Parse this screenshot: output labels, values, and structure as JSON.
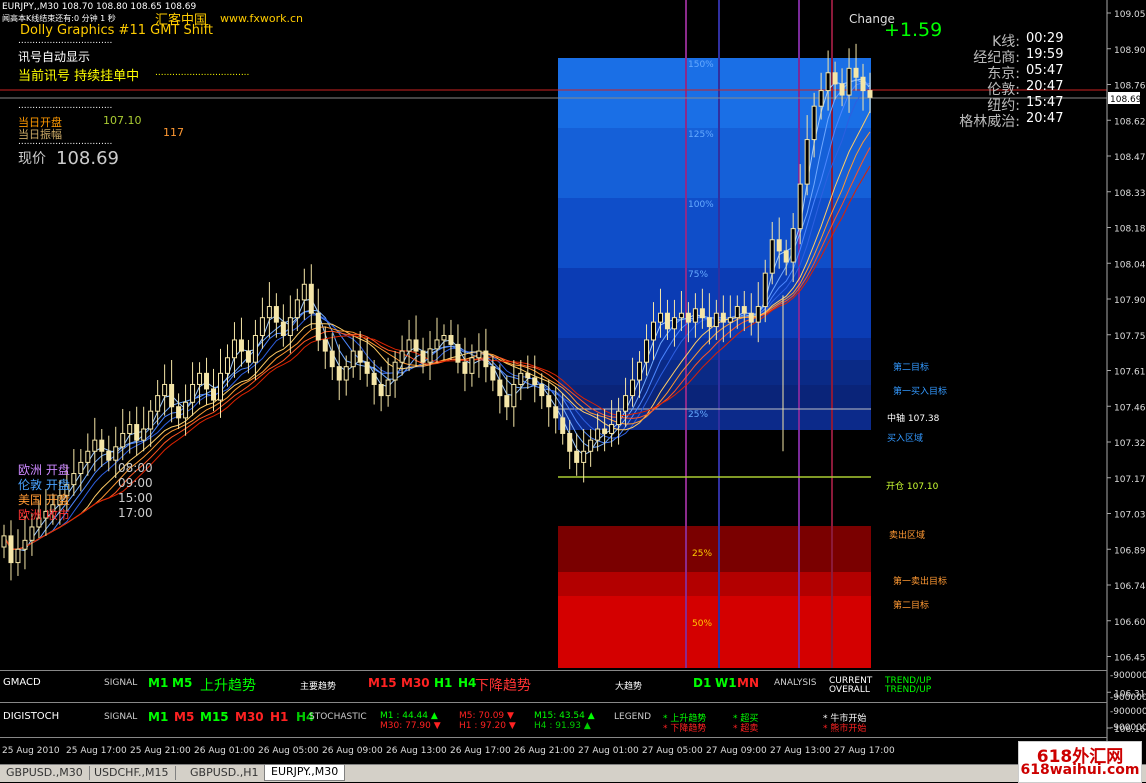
{
  "window": {
    "symbol_line": "EURJPY,,M30  108.70 108.80 108.65 108.69",
    "subtitle_line": "闻高本K线结束还有:0 分钟 1 秒",
    "brand_cn": "汇客中国",
    "brand_url": "www.fxwork.cn",
    "indicator_name": "Dolly Graphics #11 GMT Shift"
  },
  "left_panel": {
    "signal_display_label": "讯号自动显示",
    "current_signal": "当前讯号 持续挂单中",
    "dots": ".................................",
    "day_open_label": "当日开盘",
    "day_open_value": "107.10",
    "day_range_label": "当日振幅",
    "day_range_value": "117",
    "price_label": "现价",
    "price_value": "108.69"
  },
  "change": {
    "label": "Change",
    "value": "+1.59"
  },
  "clocks": [
    {
      "label": "K线:",
      "time": "00:29"
    },
    {
      "label": "经纪商:",
      "time": "19:59"
    },
    {
      "label": "东京:",
      "time": "05:47"
    },
    {
      "label": "伦敦:",
      "time": "20:47"
    },
    {
      "label": "纽约:",
      "time": "15:47"
    },
    {
      "label": "格林威治:",
      "time": "20:47"
    }
  ],
  "sessions": [
    {
      "label": "欧洲 开盘",
      "time": "08:00",
      "color": "#cc88ff"
    },
    {
      "label": "伦敦 开盘",
      "time": "09:00",
      "color": "#4aa3ff"
    },
    {
      "label": "美国 开盘",
      "time": "15:00",
      "color": "#ff9933"
    },
    {
      "label": "欧洲 收市",
      "time": "17:00",
      "color": "#ff3333"
    }
  ],
  "zones": {
    "blue_levels": [
      "150%",
      "125%",
      "100%",
      "75%",
      "25%"
    ],
    "red_levels": [
      "25%",
      "50%"
    ],
    "right_labels": [
      {
        "text": "第二目标",
        "color": "#3399ff"
      },
      {
        "text": "第一买入目标",
        "color": "#3399ff"
      },
      {
        "text": "中轴 107.38",
        "color": "#ffffff"
      },
      {
        "text": "买入区域",
        "color": "#3399ff"
      },
      {
        "text": "开仓 107.10",
        "color": "#ccff33"
      },
      {
        "text": "卖出区域",
        "color": "#ff9933"
      },
      {
        "text": "第一卖出目标",
        "color": "#ff9933"
      },
      {
        "text": "第二目标",
        "color": "#ff9933"
      }
    ]
  },
  "price_axis": {
    "ticks": [
      "109.05",
      "108.90",
      "108.76",
      "108.62",
      "108.47",
      "108.33",
      "108.18",
      "108.04",
      "107.90",
      "107.75",
      "107.61",
      "107.46",
      "107.32",
      "107.17",
      "107.03",
      "106.89",
      "106.74",
      "106.60",
      "106.45",
      "106.31",
      "106.16"
    ],
    "current_price": "108.69",
    "ind_ticks": [
      "9000000",
      "9000000",
      "9000000",
      "9000000"
    ]
  },
  "time_axis": [
    "25 Aug 2010",
    "25 Aug 17:00",
    "25 Aug 21:00",
    "26 Aug 01:00",
    "26 Aug 05:00",
    "26 Aug 09:00",
    "26 Aug 13:00",
    "26 Aug 17:00",
    "26 Aug 21:00",
    "27 Aug 01:00",
    "27 Aug 05:00",
    "27 Aug 09:00",
    "27 Aug 13:00",
    "27 Aug 17:00"
  ],
  "gmacd": {
    "name": "GMACD",
    "signal": "SIGNAL",
    "tf_up": [
      {
        "t": "M1",
        "c": "#00ff00"
      },
      {
        "t": "M5",
        "c": "#00ff00"
      }
    ],
    "up_trend": "上升趋势",
    "main_trend_label": "主要趋势",
    "tf_mid": [
      {
        "t": "M15",
        "c": "#ff2222"
      },
      {
        "t": "M30",
        "c": "#ff2222"
      },
      {
        "t": "H1",
        "c": "#00ff00"
      },
      {
        "t": "H4",
        "c": "#00ff00"
      }
    ],
    "down_trend": "下降趋势",
    "big_trend_label": "大趋势",
    "tf_big": [
      {
        "t": "D1",
        "c": "#00ff00"
      },
      {
        "t": "W1",
        "c": "#00ff00"
      },
      {
        "t": "MN",
        "c": "#ff2222"
      }
    ],
    "analysis": "ANALYSIS",
    "current": "CURRENT",
    "overall": "OVERALL",
    "trend_current": "TREND/UP",
    "trend_overall": "TREND/UP"
  },
  "digistoch": {
    "name": "DIGISTOCH",
    "signal": "SIGNAL",
    "tfs": [
      {
        "t": "M1",
        "c": "#00ff00"
      },
      {
        "t": "M5",
        "c": "#ff2222"
      },
      {
        "t": "M15",
        "c": "#00ff00"
      },
      {
        "t": "M30",
        "c": "#ff2222"
      },
      {
        "t": "H1",
        "c": "#ff2222"
      },
      {
        "t": "H4",
        "c": "#00cc00"
      }
    ],
    "stochastic": "STOCHASTIC",
    "values": [
      {
        "t": "M1 : 44.44",
        "c": "#00ff00",
        "arrow": "▲"
      },
      {
        "t": "M5: 70.09",
        "c": "#ff2222",
        "arrow": "▼"
      },
      {
        "t": "M15: 43.54",
        "c": "#00ff00",
        "arrow": "▲"
      },
      {
        "t": "M30: 77.90",
        "c": "#ff2222",
        "arrow": "▼"
      },
      {
        "t": "H1 : 97.20",
        "c": "#ff2222",
        "arrow": "▼"
      },
      {
        "t": "H4   : 91.93",
        "c": "#00cc00",
        "arrow": "▲"
      }
    ],
    "legend": "LEGEND",
    "legend_items": [
      {
        "t": "* 上升趋势",
        "c": "#00ff00"
      },
      {
        "t": "* 超买",
        "c": "#00ff00"
      },
      {
        "t": "* 牛市开始",
        "c": "#ffffff"
      },
      {
        "t": "* 下降趋势",
        "c": "#ff2222"
      },
      {
        "t": "* 超卖",
        "c": "#ff2222"
      },
      {
        "t": "* 熊市开始",
        "c": "#ff2222"
      }
    ]
  },
  "tabs": [
    "GBPUSD.,M30",
    "USDCHF.,M15",
    "GBPUSD.,H1",
    "EURJPY.,M30"
  ],
  "watermark": {
    "cn": "618外汇网",
    "url": "618waihui.com"
  },
  "chart_data": {
    "type": "candlestick",
    "symbol": "EURJPY",
    "timeframe": "M30",
    "ylim": [
      106.14,
      109.1
    ],
    "close_series": [
      106.72,
      106.6,
      106.66,
      106.7,
      106.76,
      106.8,
      106.83,
      106.86,
      106.9,
      106.95,
      107.0,
      107.05,
      107.1,
      107.15,
      107.1,
      107.06,
      107.12,
      107.18,
      107.22,
      107.15,
      107.2,
      107.28,
      107.35,
      107.4,
      107.3,
      107.25,
      107.32,
      107.4,
      107.45,
      107.38,
      107.33,
      107.45,
      107.52,
      107.6,
      107.55,
      107.5,
      107.62,
      107.7,
      107.75,
      107.68,
      107.62,
      107.7,
      107.78,
      107.85,
      107.72,
      107.6,
      107.55,
      107.48,
      107.42,
      107.48,
      107.55,
      107.5,
      107.45,
      107.4,
      107.35,
      107.42,
      107.5,
      107.55,
      107.6,
      107.55,
      107.5,
      107.56,
      107.6,
      107.62,
      107.58,
      107.5,
      107.45,
      107.52,
      107.55,
      107.48,
      107.42,
      107.35,
      107.3,
      107.4,
      107.45,
      107.43,
      107.4,
      107.35,
      107.3,
      107.25,
      107.18,
      107.1,
      107.05,
      107.1,
      107.15,
      107.2,
      107.18,
      107.22,
      107.28,
      107.35,
      107.42,
      107.5,
      107.6,
      107.68,
      107.72,
      107.65,
      107.7,
      107.72,
      107.68,
      107.74,
      107.7,
      107.66,
      107.72,
      107.68,
      107.7,
      107.75,
      107.72,
      107.68,
      107.75,
      107.9,
      108.05,
      108.0,
      107.95,
      108.1,
      108.3,
      108.5,
      108.65,
      108.72,
      108.8,
      108.75,
      108.7,
      108.82,
      108.78,
      108.72,
      108.69
    ]
  }
}
